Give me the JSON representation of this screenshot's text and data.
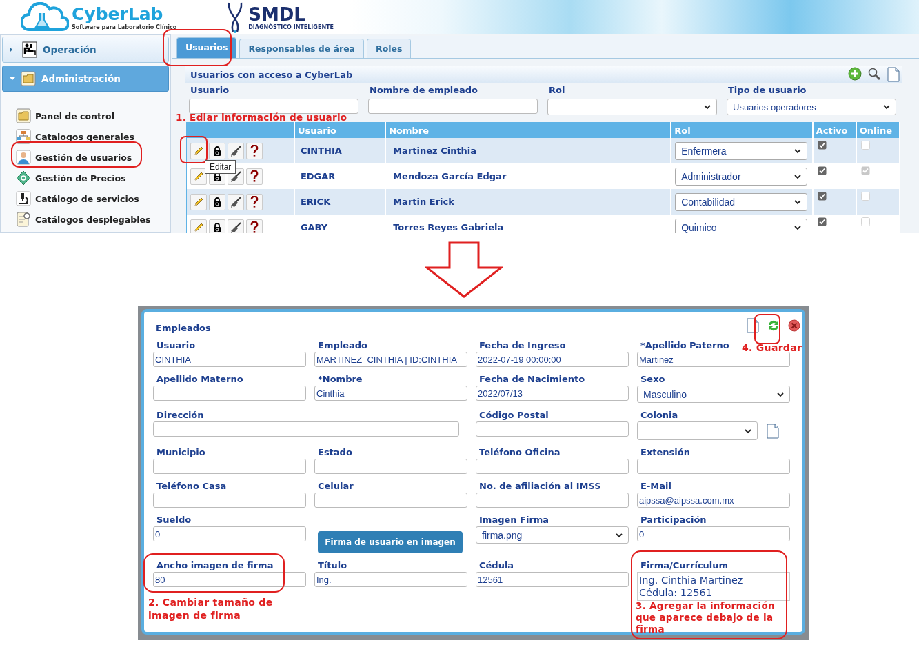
{
  "top_screen": {
    "logo": {
      "name": "CyberLab",
      "tagline": "Software para Laboratorio Clínico"
    },
    "partner_logo": {
      "name": "SMDL",
      "tagline": "DIAGNÓSTICO INTELIGENTE"
    },
    "sidebar": {
      "sections": [
        {
          "label": "Operación",
          "expanded": false
        },
        {
          "label": "Administración",
          "expanded": true,
          "items": [
            {
              "label": "Panel de control"
            },
            {
              "label": "Catalogos generales"
            },
            {
              "label": "Gestión de usuarios"
            },
            {
              "label": "Gestión de Precios"
            },
            {
              "label": "Catálogo de servicios"
            },
            {
              "label": "Catálogos desplegables"
            }
          ]
        }
      ]
    },
    "tabs": [
      {
        "label": "Usuarios",
        "selected": true
      },
      {
        "label": "Responsables de área",
        "selected": false
      },
      {
        "label": "Roles",
        "selected": false
      }
    ],
    "panel_title": "Usuarios con acceso a CyberLab",
    "filters": [
      {
        "label": "Usuario",
        "kind": "text"
      },
      {
        "label": "Nombre de empleado",
        "kind": "text"
      },
      {
        "label": "Rol",
        "kind": "select"
      },
      {
        "label": "Tipo de usuario",
        "kind": "select",
        "value": "Usuarios operadores"
      }
    ],
    "table": {
      "columns": [
        "Usuario",
        "Nombre",
        "Rol",
        "Activo",
        "Online"
      ],
      "rows": [
        {
          "usuario": "CINTHIA",
          "nombre": "Martinez Cinthia",
          "rol": "Enfermera",
          "activo": true,
          "online": false
        },
        {
          "usuario": "EDGAR",
          "nombre": "Mendoza García Edgar",
          "rol": "Administrador",
          "activo": true,
          "online": true
        },
        {
          "usuario": "ERICK",
          "nombre": "Martin Erick",
          "rol": "Contabilidad",
          "activo": true,
          "online": false
        },
        {
          "usuario": "GABY",
          "nombre": "Torres Reyes Gabriela",
          "rol": "Quimico",
          "activo": true,
          "online": false
        }
      ]
    },
    "tooltip": "Editar"
  },
  "dialog": {
    "title": "Empleados",
    "fields": [
      {
        "label": "Usuario",
        "kind": "text",
        "value": "CINTHIA"
      },
      {
        "label": "Empleado",
        "kind": "text",
        "value": "MARTINEZ  CINTHIA | ID:CINTHIA"
      },
      {
        "label": "Fecha de Ingreso",
        "kind": "text",
        "value": "2022-07-19 00:00:00"
      },
      {
        "label": "*Apellido Paterno",
        "kind": "text",
        "value": "Martinez"
      },
      {
        "label": "Apellido Materno",
        "kind": "text"
      },
      {
        "label": "*Nombre",
        "kind": "text",
        "value": "Cinthia"
      },
      {
        "label": "Fecha de Nacimiento",
        "kind": "text",
        "value": "2022/07/13"
      },
      {
        "label": "Sexo",
        "kind": "select",
        "value": "Masculino"
      },
      {
        "label": "Dirección",
        "kind": "wide"
      },
      {
        "label": "Código Postal",
        "kind": "text"
      },
      {
        "label": "Colonia",
        "kind": "select-add"
      },
      {
        "label": "Municipio",
        "kind": "text"
      },
      {
        "label": "Estado",
        "kind": "text"
      },
      {
        "label": "Teléfono Oficina",
        "kind": "text"
      },
      {
        "label": "Extensión",
        "kind": "text"
      },
      {
        "label": "Teléfono Casa",
        "kind": "text"
      },
      {
        "label": "Celular",
        "kind": "text"
      },
      {
        "label": "No. de afiliación al IMSS",
        "kind": "text"
      },
      {
        "label": "E-Mail",
        "kind": "text",
        "value": "aipssa@aipssa.com.mx"
      },
      {
        "label": "Sueldo",
        "kind": "text",
        "value": "0"
      },
      {
        "label": "Firma de usuario en imagen",
        "kind": "button"
      },
      {
        "label": "Imagen Firma",
        "kind": "select",
        "value": "firma.png"
      },
      {
        "label": "Participación",
        "kind": "text",
        "value": "0"
      },
      {
        "label": "Ancho imagen de firma",
        "kind": "text",
        "value": "80"
      },
      {
        "label": "Título",
        "kind": "text",
        "value": "Ing."
      },
      {
        "label": "Cédula",
        "kind": "text",
        "value": "12561"
      },
      {
        "label": "Firma/Currículum",
        "kind": "textarea",
        "value": "Ing. Cinthia Martinez\nCédula: 12561"
      }
    ]
  },
  "annotations": [
    {
      "text": "1. Ediar información de usuario"
    },
    {
      "text": "2. Cambiar tamaño de imagen de firma"
    },
    {
      "text": "3. Agregar la información que aparece debajo de la firma"
    },
    {
      "text": "4. Guardar"
    }
  ]
}
